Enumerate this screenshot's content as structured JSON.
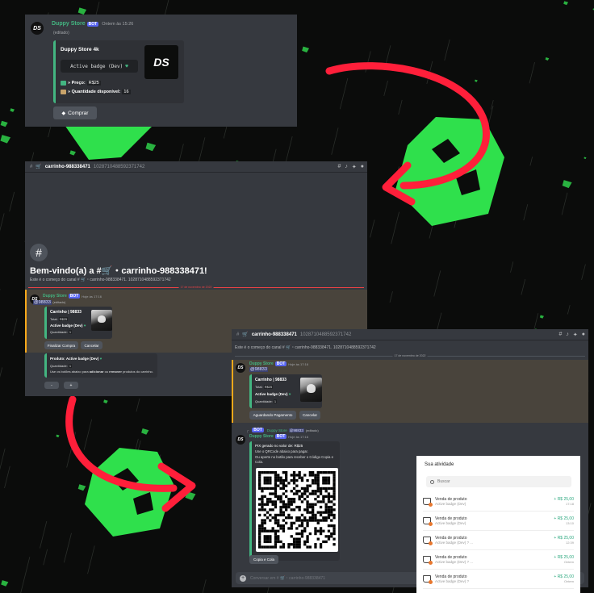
{
  "store_message": {
    "author": "Duppy Store",
    "bot_tag": "BOT",
    "timestamp": "Ontem às 15:26",
    "edited": "(editado)",
    "avatar_text": "DS",
    "embed": {
      "title": "Duppy Store 4k",
      "product_box": "Active badge (Dev)",
      "price_label": "» Preço:",
      "price_value": "R$25",
      "qty_label": "» Quantidade disponível:",
      "qty_value": "16",
      "thumb_text": "DS"
    },
    "buy_button": "Comprar"
  },
  "channel_view": {
    "channel_name": "carrinho-988338471",
    "channel_id": "1028710488592371742",
    "welcome": "Bem-vindo(a) a #🛒・carrinho-988338471!",
    "start_text": "Este é o começo do canal # 🛒・carrinho-988338471. 1028710488592371742",
    "date_divider": "17 de novembro de 2022",
    "bot_name": "Duppy Store",
    "bot_time": "Hoje às 17:16",
    "mention": "@98833",
    "edited": "(editado)",
    "cart_title": "Carrinho | 98833",
    "total_label": "Total:",
    "total_value": "R$25",
    "item": "Active badge (Dev)",
    "qty_label": "Quantidade:",
    "qty_value": "1",
    "finalize_button": "Finalizar Compra",
    "cancel_button": "Cancelar",
    "product_line": "Produto: Active badge (Dev)",
    "product_qty_label": "Quantidade:",
    "product_qty": "1",
    "hint_prefix": "Use os botões abaixo para ",
    "hint_add": "adicionar",
    "hint_mid": " ou ",
    "hint_remove": "remover",
    "hint_suffix": " produtos do carrinho.",
    "minus": "-",
    "plus": "+"
  },
  "payment_view": {
    "channel_name": "carrinho-988338471",
    "channel_id": "1028710488592371742",
    "start_text": "Este é o começo do canal # 🛒・carrinho-988338471. 1028710488592371742",
    "date_divider": "17 de novembro de 2022",
    "bot_name": "Duppy Store",
    "bot_time": "Hoje às 17:16",
    "mention": "@98833",
    "cart_title": "Carrinho | 98833",
    "total_label": "Total:",
    "total_value": "R$25",
    "item": "Active badge (Dev)",
    "qty_label": "Quantidade:",
    "qty_value": "1",
    "waiting_button": "Aguardando Pagamento",
    "cancel_button": "Cancelar",
    "reply_bot": "Duppy Store",
    "reply_mention": "@98833",
    "reply_edited": "(editado)",
    "pix_line": "PIX gerado no valor de: R$25",
    "qr_line": "Use o QRCode abaixo para pagar.",
    "copy_line": "Ou aperte no botão para receber o Código Copia e Cola.",
    "copy_button": "Copia e Cola",
    "input_placeholder": "Conversar em # 🛒・carrinho-988338471"
  },
  "activity": {
    "title": "Sua atividade",
    "search_placeholder": "Buscar",
    "rows": [
      {
        "title": "Venda de produto",
        "sub": "Active badge (Dev)",
        "amount": "+ R$ 25,00",
        "time": "17:18"
      },
      {
        "title": "Venda de produto",
        "sub": "Active badge (Dev)",
        "amount": "+ R$ 25,00",
        "time": "13:10"
      },
      {
        "title": "Venda de produto",
        "sub": "Active badge (Dev) ? ...",
        "amount": "+ R$ 25,00",
        "time": "12:39"
      },
      {
        "title": "Venda de produto",
        "sub": "Active badge (Dev) ? ...",
        "amount": "+ R$ 25,00",
        "time": "Ontem"
      },
      {
        "title": "Venda de produto",
        "sub": "Active badge (Dev) ?",
        "amount": "+ R$ 25,00",
        "time": "Ontem"
      }
    ]
  },
  "colors": {
    "accent_green": "#2fe04c",
    "arrow_red": "#ff1f3a",
    "discord_bg": "#36393f",
    "blurple": "#5865f2"
  }
}
